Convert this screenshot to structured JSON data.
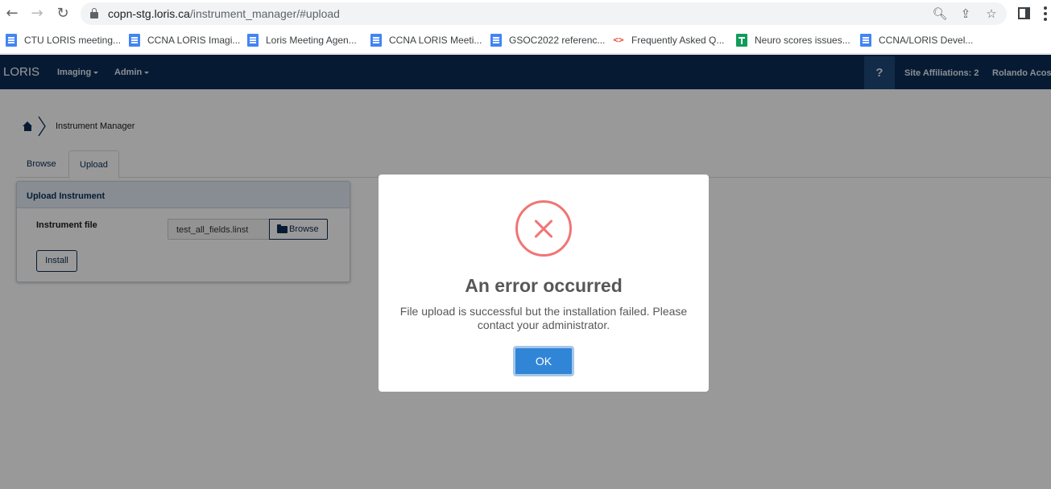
{
  "browser": {
    "url_host": "copn-stg.loris.ca",
    "url_path": "/instrument_manager/#upload",
    "bookmarks": [
      {
        "icon": "doc-icon",
        "label": "CTU LORIS meeting..."
      },
      {
        "icon": "doc-icon",
        "label": "CCNA LORIS Imagi..."
      },
      {
        "icon": "doc-icon",
        "label": "Loris Meeting Agen..."
      },
      {
        "icon": "doc-icon",
        "label": "CCNA LORIS Meeti..."
      },
      {
        "icon": "doc-icon",
        "label": "GSOC2022 referenc..."
      },
      {
        "icon": "code-icon",
        "label": "Frequently Asked Q..."
      },
      {
        "icon": "sheet-icon",
        "label": "Neuro scores issues..."
      },
      {
        "icon": "doc-icon",
        "label": "CCNA/LORIS Devel..."
      }
    ]
  },
  "navbar": {
    "brand": "LORIS",
    "menus": [
      "Imaging",
      "Admin"
    ],
    "help": "?",
    "site_affiliations": "Site Affiliations: 2",
    "user": "Rolando Acost"
  },
  "breadcrumb": {
    "current": "Instrument Manager"
  },
  "tabs": [
    "Browse",
    "Upload"
  ],
  "panel": {
    "title": "Upload Instrument",
    "field_label": "Instrument file",
    "file_value": "test_all_fields.linst",
    "browse_label": "Browse",
    "install_label": "Install"
  },
  "modal": {
    "title": "An error occurred",
    "message": "File upload is successful but the installation failed. Please contact your administrator.",
    "ok_label": "OK"
  },
  "colors": {
    "navbar": "#0a2d55",
    "error": "#f27474",
    "ok_button": "#3085d6"
  }
}
